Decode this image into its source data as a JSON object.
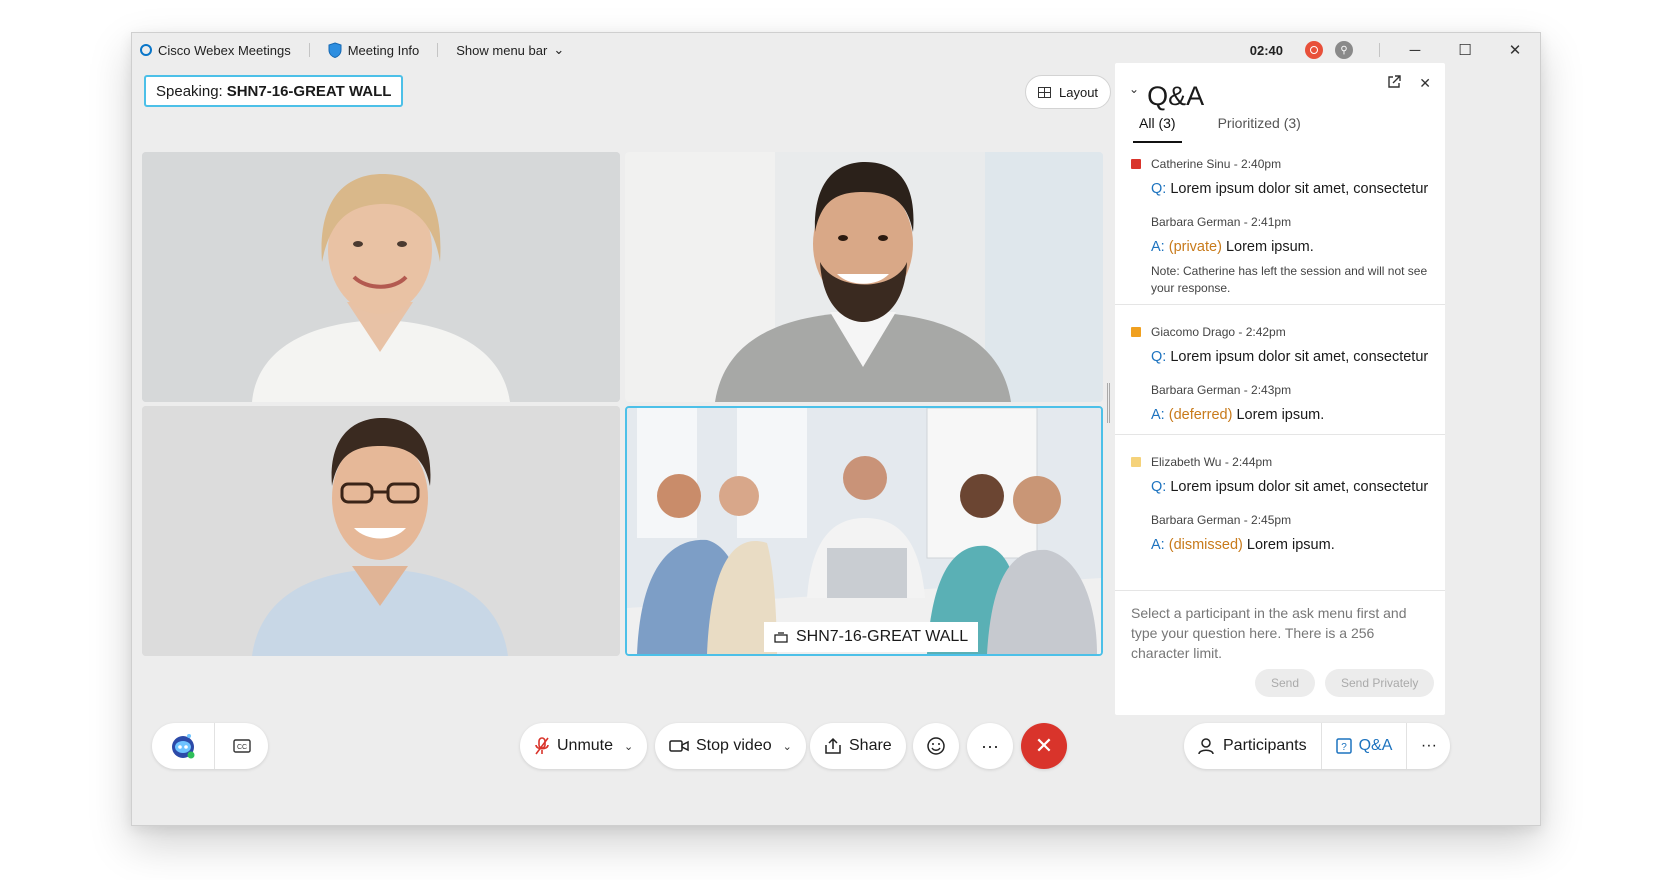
{
  "titlebar": {
    "app_name": "Cisco Webex Meetings",
    "meeting_info": "Meeting Info",
    "show_menu_bar": "Show menu bar",
    "timer": "02:40",
    "minimize": "─",
    "maximize": "☐",
    "close": "✕"
  },
  "stage": {
    "speaking_prefix": "Speaking:",
    "speaking_name": "SHN7-16-GREAT WALL",
    "layout_label": "Layout",
    "room_label": "SHN7-16-GREAT WALL"
  },
  "toolbar": {
    "unmute": "Unmute",
    "stop_video": "Stop video",
    "share": "Share",
    "more": "···",
    "end": "✕",
    "participants": "Participants",
    "qa": "Q&A",
    "more_right": "···"
  },
  "qa": {
    "title": "Q&A",
    "tabs": [
      {
        "label": "All (3)",
        "active": true
      },
      {
        "label": "Prioritized (3)",
        "active": false
      }
    ],
    "threads": [
      {
        "color": "#d9342b",
        "asker": "Catherine Sinu - 2:40pm",
        "q_label": "Q:",
        "question": "Lorem ipsum dolor sit amet, consectetur",
        "answerer": "Barbara German - 2:41pm",
        "a_label": "A:",
        "status": "(private)",
        "answer": "Lorem ipsum.",
        "note": "Note: Catherine has left the session and will not see your response."
      },
      {
        "color": "#f0a020",
        "asker": "Giacomo Drago - 2:42pm",
        "q_label": "Q:",
        "question": "Lorem ipsum dolor sit amet, consectetur",
        "answerer": "Barbara German - 2:43pm",
        "a_label": "A:",
        "status": "(deferred)",
        "answer": "Lorem ipsum."
      },
      {
        "color": "#f5d27a",
        "asker": "Elizabeth Wu - 2:44pm",
        "q_label": "Q:",
        "question": "Lorem ipsum dolor sit amet, consectetur",
        "answerer": "Barbara German - 2:45pm",
        "a_label": "A:",
        "status": "(dismissed)",
        "answer": "Lorem ipsum."
      }
    ],
    "input_placeholder": "Select a participant in the ask menu first and type your question here. There is a 256 character limit.",
    "send": "Send",
    "send_privately": "Send Privately"
  },
  "icons": {
    "app": "webex-logo-icon",
    "shield": "shield-icon",
    "record": "record-icon",
    "lock": "lock-icon",
    "layout": "grid-icon",
    "assistant": "assistant-bot-icon",
    "captions": "closed-captions-icon",
    "mic": "microphone-muted-icon",
    "video": "video-camera-icon",
    "share": "share-icon",
    "reactions": "emoji-icon",
    "participants": "person-icon",
    "qa": "question-icon",
    "popout": "popout-icon",
    "close": "close-icon",
    "room": "room-device-icon"
  },
  "colors": {
    "accent": "#1d73bf",
    "active_speaker": "#4cc0e8",
    "end_call": "#d9342b",
    "status": "#c87a1a"
  }
}
